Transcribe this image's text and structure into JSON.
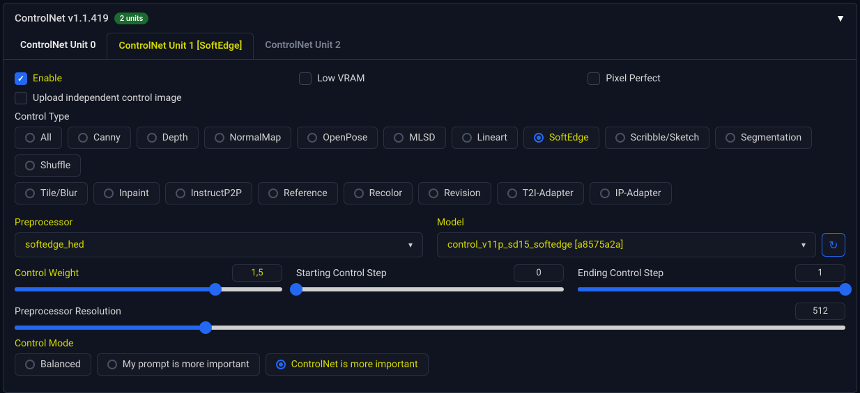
{
  "header": {
    "title": "ControlNet v1.1.419",
    "badge": "2 units"
  },
  "tabs": [
    {
      "label": "ControlNet Unit 0",
      "active": false,
      "dim": false
    },
    {
      "label": "ControlNet Unit 1 [SoftEdge]",
      "active": true,
      "dim": false
    },
    {
      "label": "ControlNet Unit 2",
      "active": false,
      "dim": true
    }
  ],
  "checkboxes": {
    "enable": {
      "label": "Enable",
      "checked": true
    },
    "low_vram": {
      "label": "Low VRAM",
      "checked": false
    },
    "pixel_perfect": {
      "label": "Pixel Perfect",
      "checked": false
    },
    "upload_independent": {
      "label": "Upload independent control image",
      "checked": false
    }
  },
  "control_type": {
    "label": "Control Type",
    "options_row1": [
      "All",
      "Canny",
      "Depth",
      "NormalMap",
      "OpenPose",
      "MLSD",
      "Lineart",
      "SoftEdge",
      "Scribble/Sketch",
      "Segmentation",
      "Shuffle"
    ],
    "options_row2": [
      "Tile/Blur",
      "Inpaint",
      "InstructP2P",
      "Reference",
      "Recolor",
      "Revision",
      "T2I-Adapter",
      "IP-Adapter"
    ],
    "selected": "SoftEdge"
  },
  "preprocessor": {
    "label": "Preprocessor",
    "value": "softedge_hed"
  },
  "model": {
    "label": "Model",
    "value": "control_v11p_sd15_softedge [a8575a2a]"
  },
  "sliders": {
    "control_weight": {
      "label": "Control Weight",
      "value": "1,5",
      "percent": 75
    },
    "starting_step": {
      "label": "Starting Control Step",
      "value": "0",
      "percent": 0
    },
    "ending_step": {
      "label": "Ending Control Step",
      "value": "1",
      "percent": 100
    },
    "preproc_resolution": {
      "label": "Preprocessor Resolution",
      "value": "512",
      "percent": 23
    }
  },
  "control_mode": {
    "label": "Control Mode",
    "options": [
      "Balanced",
      "My prompt is more important",
      "ControlNet is more important"
    ],
    "selected": "ControlNet is more important"
  }
}
